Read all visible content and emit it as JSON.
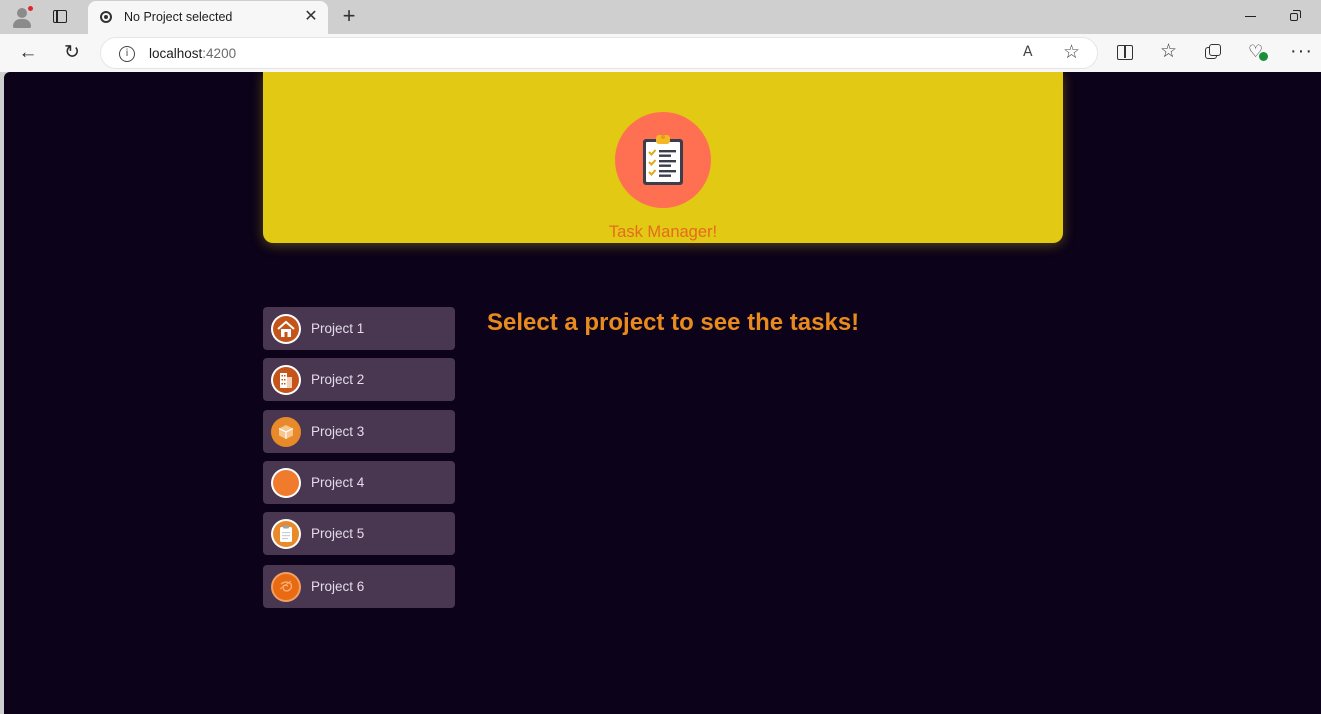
{
  "browser": {
    "tab_title": "No Project selected",
    "tab_close": "✕",
    "new_tab": "+",
    "url_host": "localhost",
    "url_port": ":4200",
    "read_aloud_label": "A",
    "favorite_star": "☆",
    "favorites_glyph": "☆",
    "more_glyph": "···",
    "back_glyph": "←",
    "refresh_glyph": "↻",
    "info_glyph": "i"
  },
  "header": {
    "title": "Task Manager!",
    "logo_icon": "clipboard-checklist-icon",
    "background": "#e1c914",
    "logo_background": "#ff7053"
  },
  "projects": [
    {
      "label": "Project 1",
      "avatar": "house-icon"
    },
    {
      "label": "Project 2",
      "avatar": "building-icon"
    },
    {
      "label": "Project 3",
      "avatar": "box-icon"
    },
    {
      "label": "Project 4",
      "avatar": "orange-circle-icon"
    },
    {
      "label": "Project 5",
      "avatar": "clipboard-icon"
    },
    {
      "label": "Project 6",
      "avatar": "orange-swirl-icon"
    }
  ],
  "main": {
    "prompt": "Select a project to see the tasks!"
  },
  "colors": {
    "page_background": "#0c0219",
    "project_button": "#493651",
    "accent_orange": "#e98a1e"
  }
}
